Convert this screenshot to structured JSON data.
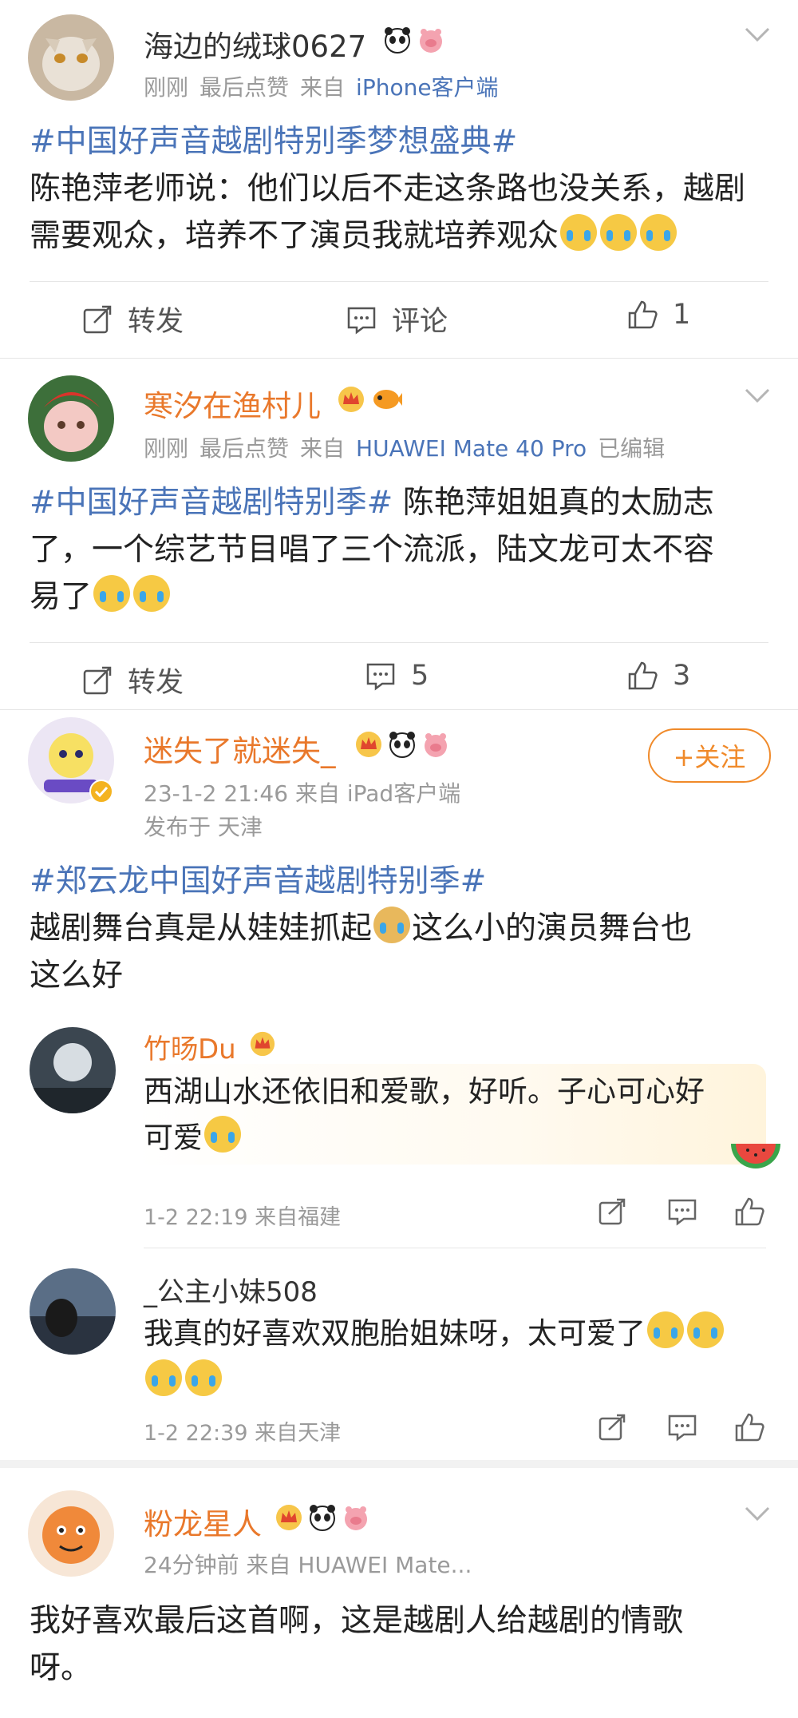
{
  "colors": {
    "link": "#4a74b8",
    "orange_name": "#e9782b",
    "meta": "#9a9a9a",
    "follow": "#f08a2a"
  },
  "comments": [
    {
      "username": "海边的绒球0627",
      "meta": [
        "刚刚",
        "最后点赞",
        "来自",
        "iPhone客户端"
      ],
      "hashtag": "#中国好声音越剧特别季梦想盛典#",
      "text": "陈艳萍老师说：他们以后不走这条路也没关系，越剧需要观众，培养不了演员我就培养观众",
      "actions": {
        "repost": "转发",
        "comment": "评论",
        "like": "1"
      }
    },
    {
      "username": "寒汐在渔村儿",
      "meta": [
        "刚刚",
        "最后点赞",
        "来自",
        "HUAWEI Mate 40 Pro",
        "已编辑"
      ],
      "hashtag": "#中国好声音越剧特别季#",
      "text_line1": " 陈艳萍姐姐真的太励志",
      "text_line2": "了，一个综艺节目唱了三个流派，陆文龙可太不容",
      "text_line3": "易了",
      "actions": {
        "repost": "转发",
        "comment": "5",
        "like": "3"
      }
    },
    {
      "username": "迷失了就迷失_",
      "meta": "23-1-2 21:46  来自 iPad客户端",
      "location": "发布于 天津",
      "follow": "+关注",
      "hashtag": "#郑云龙中国好声音越剧特别季#",
      "text_line1a": "越剧舞台真是从娃娃抓起",
      "text_line1b": "这么小的演员舞台也",
      "text_line2": "这么好",
      "replies": [
        {
          "username": "竹旸Du",
          "text_line1": "西湖山水还依旧和爱歌，好听。子心可心好",
          "text_line2": "可爱",
          "meta": "1-2 22:19  来自福建"
        },
        {
          "username": "_公主小妹508",
          "text_line1": "我真的好喜欢双胞胎姐妹呀，太可爱了",
          "meta": "1-2 22:39  来自天津"
        }
      ]
    },
    {
      "username": "粉龙星人",
      "meta": "24分钟前  来自 HUAWEI Mate...",
      "text_line1": "我好喜欢最后这首啊，这是越剧人给越剧的情歌",
      "text_line2": "呀。"
    }
  ]
}
